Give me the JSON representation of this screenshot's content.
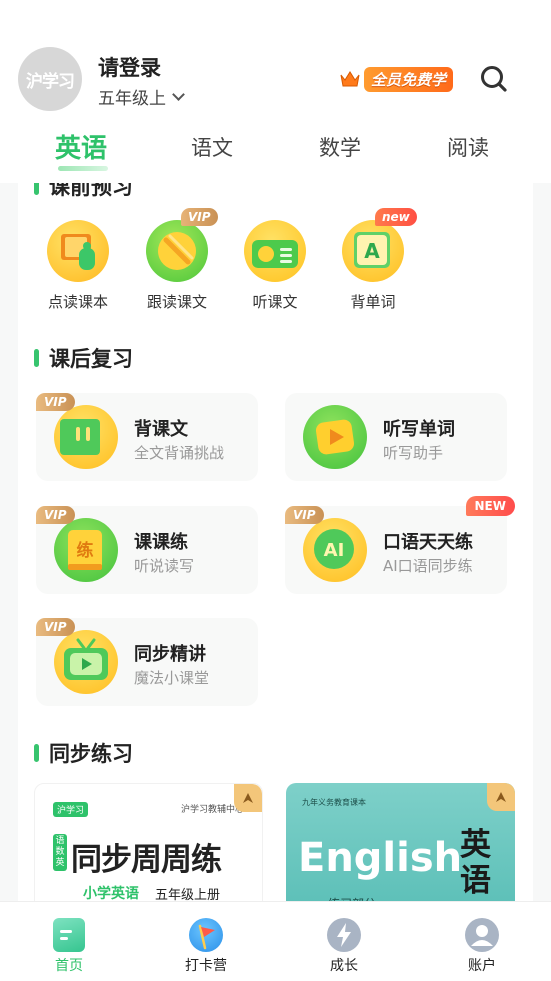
{
  "header": {
    "avatar_text": "沪学习",
    "login_label": "请登录",
    "grade_label": "五年级上",
    "vip_free_label": "全员免费学"
  },
  "tabs": [
    {
      "label": "英语",
      "active": true
    },
    {
      "label": "语文",
      "active": false
    },
    {
      "label": "数学",
      "active": false
    },
    {
      "label": "阅读",
      "active": false
    }
  ],
  "preview": {
    "title": "课前预习",
    "items": [
      {
        "label": "点读课本",
        "icon": "book-pointer-icon",
        "badge": ""
      },
      {
        "label": "跟读课文",
        "icon": "microphone-icon",
        "badge": "VIP"
      },
      {
        "label": "听课文",
        "icon": "radio-icon",
        "badge": ""
      },
      {
        "label": "背单词",
        "icon": "word-card-icon",
        "badge": "new"
      }
    ]
  },
  "review": {
    "title": "课后复习",
    "cards": [
      {
        "title": "背课文",
        "subtitle": "全文背诵挑战",
        "icon": "scroll-icon",
        "vip": "VIP",
        "new": ""
      },
      {
        "title": "听写单词",
        "subtitle": "听写助手",
        "icon": "play-icon",
        "vip": "",
        "new": ""
      },
      {
        "title": "课课练",
        "subtitle": "听说读写",
        "icon": "practice-book-icon",
        "vip": "VIP",
        "new": ""
      },
      {
        "title": "口语天天练",
        "subtitle": "AI口语同步练",
        "icon": "ai-speak-icon",
        "vip": "VIP",
        "new": "NEW"
      },
      {
        "title": "同步精讲",
        "subtitle": "魔法小课堂",
        "icon": "tv-icon",
        "vip": "VIP",
        "new": ""
      }
    ]
  },
  "practice": {
    "title": "同步练习",
    "books": [
      {
        "brand": "沪学习",
        "publisher": "沪学习教辅中心",
        "side_tag": "语数英",
        "title": "同步周周练",
        "subtitle": "小学英语",
        "grade": "五年级上册"
      },
      {
        "header": "九年义务教育课本",
        "title": "English",
        "side_title": "英语",
        "footer": "练习部分"
      }
    ]
  },
  "bottom_nav": [
    {
      "label": "首页",
      "icon": "home-icon",
      "active": true
    },
    {
      "label": "打卡营",
      "icon": "flag-icon",
      "active": false
    },
    {
      "label": "成长",
      "icon": "lightning-icon",
      "active": false
    },
    {
      "label": "账户",
      "icon": "user-icon",
      "active": false
    }
  ],
  "colors": {
    "accent": "#2ec26a",
    "vip": "#c99155",
    "new": "#ff4f44"
  }
}
